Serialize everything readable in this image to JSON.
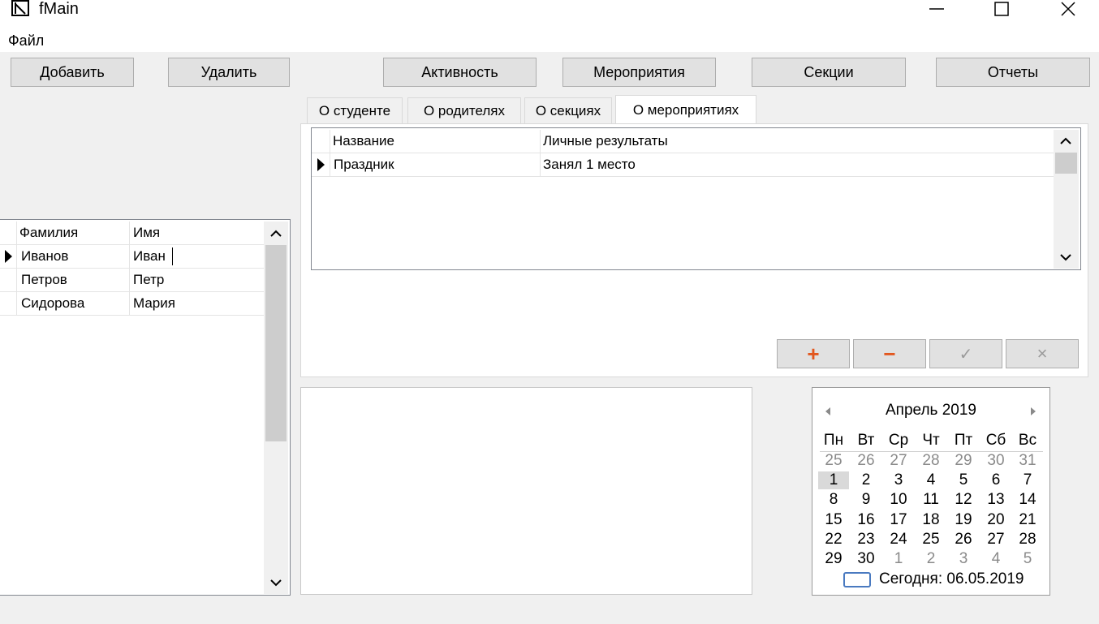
{
  "window": {
    "title": "fMain"
  },
  "menu": {
    "file": "Файл"
  },
  "toolbar": {
    "add": "Добавить",
    "delete": "Удалить",
    "activity": "Активность",
    "events": "Мероприятия",
    "sections": "Секции",
    "reports": "Отчеты"
  },
  "students": {
    "columns": [
      "Фамилия",
      "Имя"
    ],
    "rows": [
      {
        "last": "Иванов",
        "first": "Иван"
      },
      {
        "last": "Петров",
        "first": "Петр"
      },
      {
        "last": "Сидорова",
        "first": "Мария"
      }
    ]
  },
  "tabs": [
    "О студенте",
    "О родителях",
    "О секциях",
    "О мероприятиях"
  ],
  "events_grid": {
    "columns": [
      "Название",
      "Личные результаты"
    ],
    "rows": [
      {
        "name": "Праздник",
        "result": "Занял 1 место"
      }
    ]
  },
  "nav_buttons": {
    "add": "+",
    "remove": "−",
    "confirm": "✓",
    "cancel": "×"
  },
  "calendar": {
    "month_label": "Апрель 2019",
    "weekdays": [
      "Пн",
      "Вт",
      "Ср",
      "Чт",
      "Пт",
      "Сб",
      "Вс"
    ],
    "weeks": [
      [
        "25",
        "26",
        "27",
        "28",
        "29",
        "30",
        "31"
      ],
      [
        "1",
        "2",
        "3",
        "4",
        "5",
        "6",
        "7"
      ],
      [
        "8",
        "9",
        "10",
        "11",
        "12",
        "13",
        "14"
      ],
      [
        "15",
        "16",
        "17",
        "18",
        "19",
        "20",
        "21"
      ],
      [
        "22",
        "23",
        "24",
        "25",
        "26",
        "27",
        "28"
      ],
      [
        "29",
        "30",
        "1",
        "2",
        "3",
        "4",
        "5"
      ]
    ],
    "today_label": "Сегодня: 06.05.2019"
  }
}
